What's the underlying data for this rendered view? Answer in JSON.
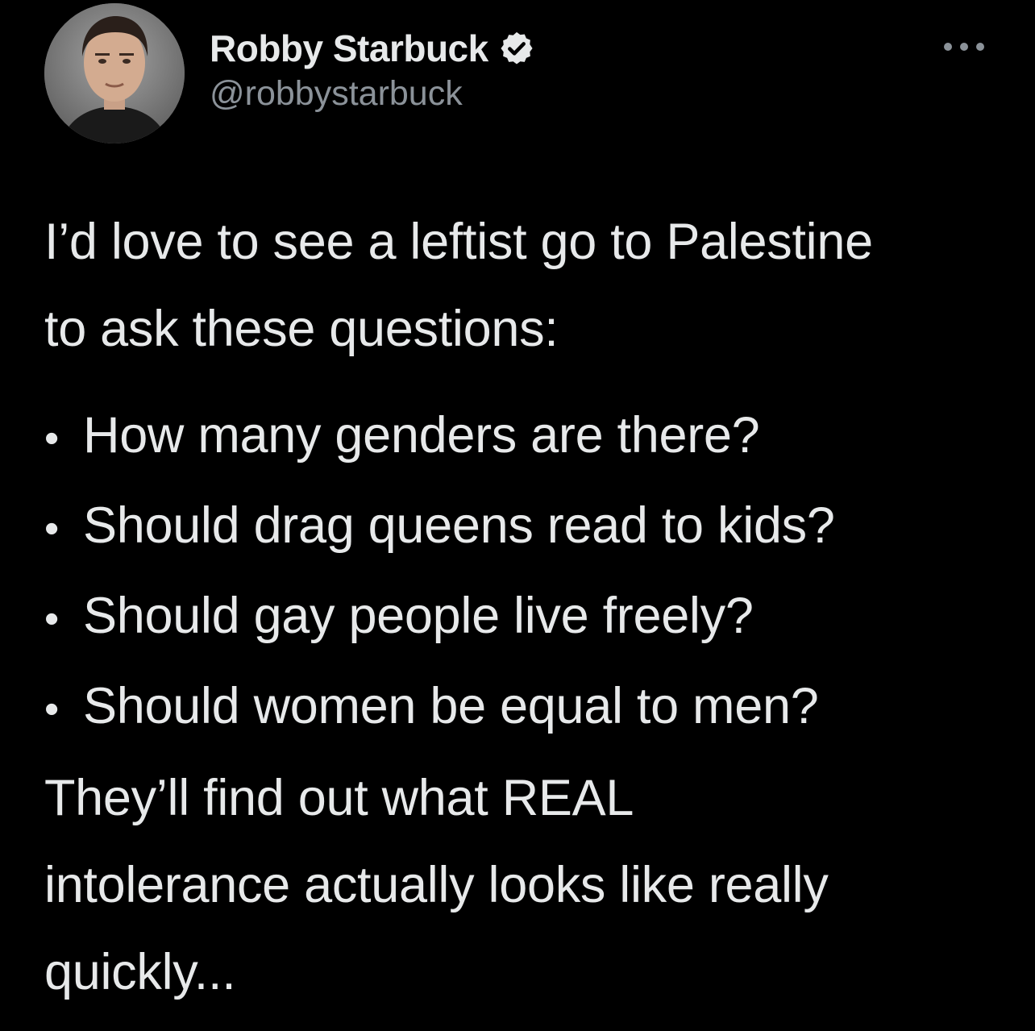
{
  "author": {
    "display_name": "Robby Starbuck",
    "handle": "@robbystarbuck",
    "verified": true,
    "avatar_icon": "profile-photo"
  },
  "tweet": {
    "intro_lines": [
      "I’d love to see a leftist go to Palestine",
      "to ask these questions:"
    ],
    "bullet_symbol": "•",
    "questions": [
      "How many genders are there?",
      "Should drag queens read to kids?",
      "Should gay people live freely?",
      "Should women be equal to men?"
    ],
    "closing_lines": [
      "They’ll find out what REAL",
      "intolerance actually looks like really",
      "quickly..."
    ]
  },
  "colors": {
    "background": "#000000",
    "text_primary": "#e7e9ea",
    "text_secondary": "#8b9299",
    "verified_badge": "#e7e9ea"
  },
  "icons": {
    "more": "more-horizontal-icon",
    "verified": "verified-badge-icon"
  }
}
